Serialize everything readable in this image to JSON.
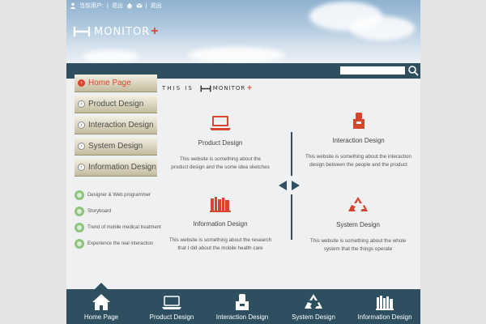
{
  "header": {
    "topbar": {
      "user_label": "当前用户:",
      "link_exit": "退出",
      "link_logout": "退出"
    },
    "logo_text": "MONITOR",
    "logo_plus": "+"
  },
  "search": {
    "value": "",
    "placeholder": ""
  },
  "sidebar": {
    "items": [
      {
        "label": "Home Page",
        "active": true
      },
      {
        "label": "Product Design",
        "active": false
      },
      {
        "label": "Interaction Design",
        "active": false
      },
      {
        "label": "System Design",
        "active": false
      },
      {
        "label": "Information Design",
        "active": false
      }
    ],
    "links": [
      {
        "label": "Designer & Web programmer"
      },
      {
        "label": "Storyboard"
      },
      {
        "label": "Trend of mobile medical treatment"
      },
      {
        "label": "Experience the real interaction"
      }
    ]
  },
  "main": {
    "heading": "THIS IS",
    "heading_logo": "MONITOR",
    "heading_plus": "+",
    "features": [
      {
        "icon": "laptop-icon",
        "title": "Product Design",
        "desc_1": "This website is something about the",
        "desc_2": "product design and the some idea sketches"
      },
      {
        "icon": "hand-box-icon",
        "title": "Interaction Design",
        "desc_1": "This website is something about the interaction",
        "desc_2": "design between the people and the product"
      },
      {
        "icon": "books-icon",
        "title": "Information Design",
        "desc_1": "This website is something about the research",
        "desc_2": "that I did about the mobile health care"
      },
      {
        "icon": "recycle-icon",
        "title": "System Design",
        "desc_1": "This website is something about the whole",
        "desc_2": "system that the things operate"
      }
    ]
  },
  "bottom_nav": [
    {
      "icon": "home-icon",
      "label": "Home Page"
    },
    {
      "icon": "laptop-icon",
      "label": "Product Design"
    },
    {
      "icon": "hand-box-icon",
      "label": "Interaction Design"
    },
    {
      "icon": "recycle-icon",
      "label": "System Design"
    },
    {
      "icon": "books-icon",
      "label": "Information Design"
    }
  ],
  "colors": {
    "nav_dark": "#2d4f5f",
    "accent_red": "#d8452f",
    "link_green": "#8cc47e"
  }
}
